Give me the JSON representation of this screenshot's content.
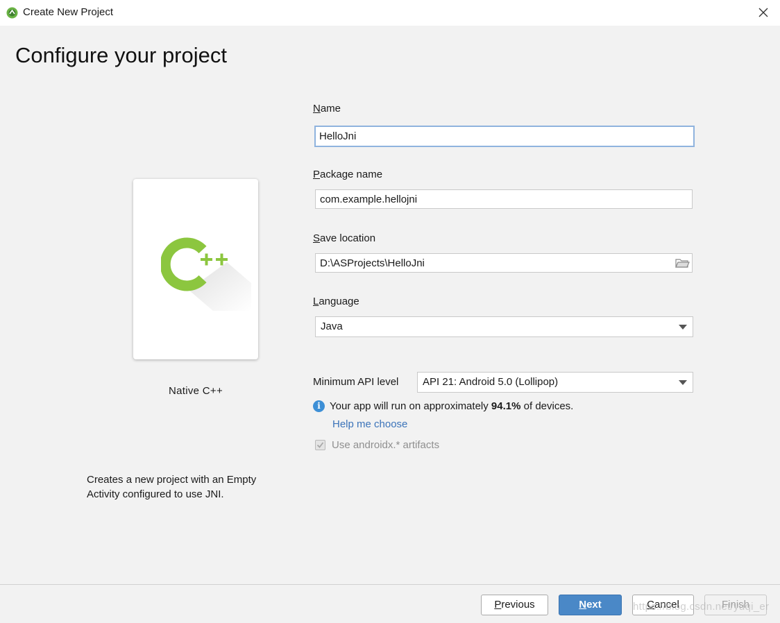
{
  "window": {
    "title": "Create New Project",
    "app_icon": "android-studio-icon",
    "close_icon": "close-icon"
  },
  "heading": "Configure your project",
  "template": {
    "name": "Native C++",
    "icon": "cpp-icon",
    "description_line1": "Creates a new project with an Empty",
    "description_line2": "Activity configured to use JNI."
  },
  "form": {
    "name": {
      "label_mnemonic": "N",
      "label_rest": "ame",
      "value": "HelloJni"
    },
    "package": {
      "label_mnemonic": "P",
      "label_rest": "ackage name",
      "value": "com.example.hellojni"
    },
    "save_location": {
      "label_mnemonic": "S",
      "label_rest": "ave location",
      "value": "D:\\ASProjects\\HelloJni",
      "icon": "folder-icon"
    },
    "language": {
      "label_mnemonic": "L",
      "label_rest": "anguage",
      "value": "Java"
    },
    "min_api": {
      "label": "Minimum API level",
      "value": "API 21: Android 5.0 (Lollipop)"
    },
    "info": {
      "icon": "info-icon",
      "text_before": "Your app will run on approximately ",
      "percent": "94.1%",
      "text_after": " of devices."
    },
    "help_link": "Help me choose",
    "androidx": {
      "label": "Use androidx.* artifacts",
      "checked": true,
      "enabled": false
    }
  },
  "buttons": {
    "previous": {
      "mnemonic": "P",
      "rest": "revious"
    },
    "next": {
      "mnemonic": "N",
      "rest": "ext"
    },
    "cancel": {
      "mnemonic": "C",
      "rest": "ancel"
    },
    "finish": "Finish"
  },
  "watermark": "https://blog.csdn.net/yuqi_er"
}
